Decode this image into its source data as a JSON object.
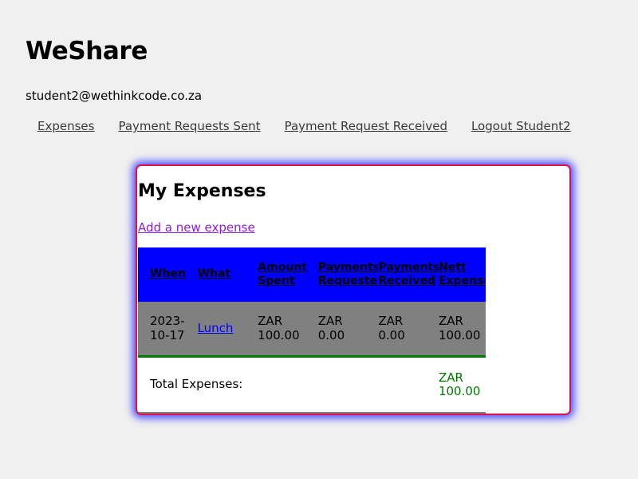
{
  "app": {
    "title": "WeShare",
    "user_email": "student2@wethinkcode.co.za"
  },
  "nav": {
    "items": [
      {
        "label": "Expenses"
      },
      {
        "label": "Payment Requests Sent"
      },
      {
        "label": "Payment Request Received"
      },
      {
        "label": "Logout Student2"
      }
    ]
  },
  "expenses": {
    "title": "My Expenses",
    "add_link": "Add a new expense",
    "table": {
      "headers": {
        "when": "When",
        "what": "What",
        "amount_line1": "Amount",
        "amount_line2": "Spent",
        "requested_line1": "Payments",
        "requested_line2": "Requested",
        "received_line1": "Payments",
        "received_line2": "Received",
        "nett_line1": "Nett",
        "nett_line2": "Expense"
      },
      "rows": [
        {
          "when_line1": "2023-",
          "when_line2": "10-17",
          "what": "Lunch",
          "amount_currency": "ZAR",
          "amount_value": "100.00",
          "requested_currency": "ZAR",
          "requested_value": "0.00",
          "received_currency": "ZAR",
          "received_value": "0.00",
          "nett_currency": "ZAR",
          "nett_value": "100.00"
        }
      ],
      "total": {
        "label": "Total Expenses:",
        "currency": "ZAR",
        "value": "100.00"
      }
    }
  },
  "colors": {
    "background": "#f0f0f0",
    "card_border": "#dc1346",
    "card_glow": "#4f4fff",
    "header_bg": "#0000ff",
    "row_bg": "#808080",
    "link_purple": "#8c1ee0",
    "positive_green": "#007800",
    "negative_red": "#ff0000",
    "neutral_blue": "#0000ff"
  }
}
